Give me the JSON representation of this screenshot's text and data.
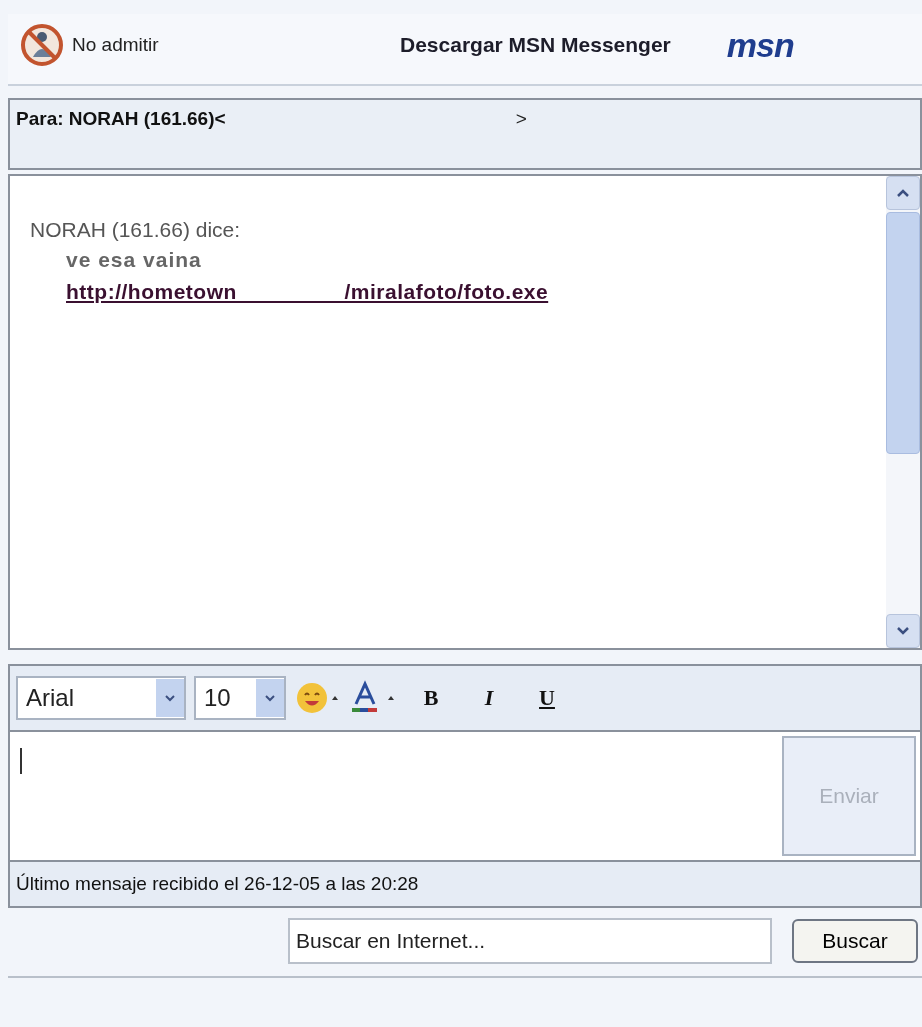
{
  "header": {
    "block_label": "No admitir",
    "download_link": "Descargar MSN Messenger",
    "logo": "msn"
  },
  "to_bar": {
    "label": "Para: NORAH (161.66)<",
    "tail": ">"
  },
  "conversation": {
    "messages": [
      {
        "sender": "NORAH (161.66) dice:",
        "lines": [
          {
            "kind": "text",
            "text": "ve esa vaina"
          },
          {
            "kind": "link",
            "text": "http://hometown                 /miralafoto/foto.exe"
          }
        ]
      }
    ]
  },
  "toolbar": {
    "font": "Arial",
    "size": "10",
    "format_buttons": [
      {
        "kind": "bold",
        "text": "B"
      },
      {
        "kind": "italic",
        "text": "I"
      },
      {
        "kind": "underline",
        "text": "U"
      }
    ]
  },
  "compose": {
    "send_button": {
      "label": "Enviar",
      "disabled": true
    }
  },
  "status": "Último mensaje recibido el 26-12-05 a las 20:28",
  "search": {
    "value": "Buscar en Internet...",
    "button": "Buscar"
  }
}
